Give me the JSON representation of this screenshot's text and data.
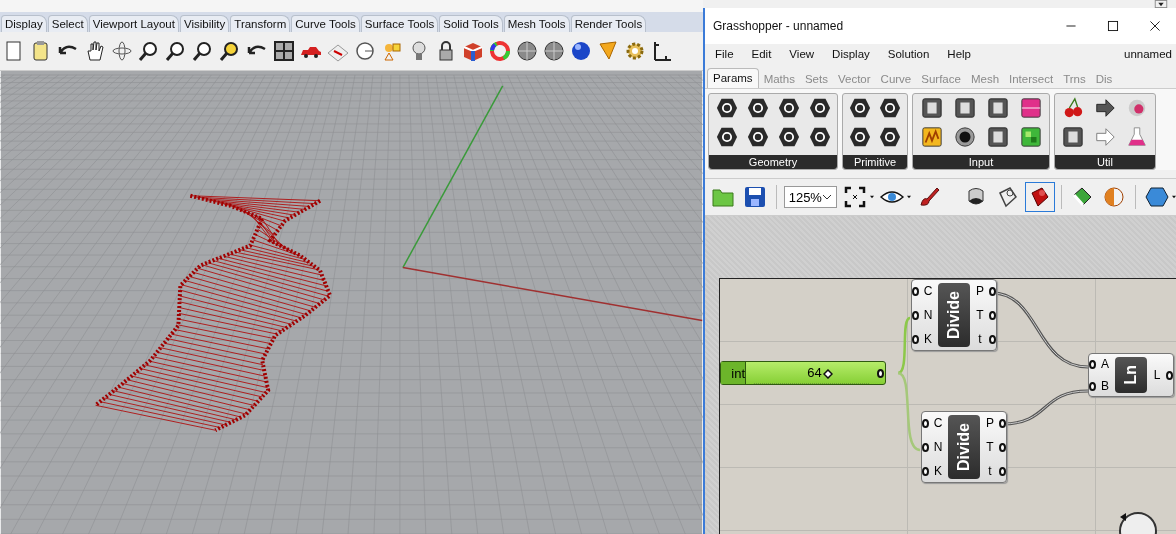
{
  "rhino": {
    "tabs": [
      {
        "label": "Display"
      },
      {
        "label": "Select"
      },
      {
        "label": "Viewport Layout"
      },
      {
        "label": "Visibility"
      },
      {
        "label": "Transform"
      },
      {
        "label": "Curve Tools"
      },
      {
        "label": "Surface Tools"
      },
      {
        "label": "Solid Tools"
      },
      {
        "label": "Mesh Tools"
      },
      {
        "label": "Render Tools"
      }
    ]
  },
  "grasshopper": {
    "title": "Grasshopper - unnamed",
    "menu": [
      "File",
      "Edit",
      "View",
      "Display",
      "Solution",
      "Help"
    ],
    "document_name": "unnamed",
    "tabs": [
      {
        "label": "Params",
        "selected": true
      },
      {
        "label": "Maths",
        "selected": false
      },
      {
        "label": "Sets",
        "selected": false
      },
      {
        "label": "Vector",
        "selected": false
      },
      {
        "label": "Curve",
        "selected": false
      },
      {
        "label": "Surface",
        "selected": false
      },
      {
        "label": "Mesh",
        "selected": false
      },
      {
        "label": "Intersect",
        "selected": false
      },
      {
        "label": "Trns",
        "selected": false
      },
      {
        "label": "Dis",
        "selected": false
      }
    ],
    "panels": [
      "Geometry",
      "Primitive",
      "Input",
      "Util"
    ],
    "zoom": "125%",
    "preview_modes": [
      {
        "selected": false
      },
      {
        "selected": false
      },
      {
        "selected": true
      }
    ],
    "canvas": {
      "slider": {
        "label": "int",
        "value": "64",
        "level": 0.64
      },
      "components": [
        {
          "name": "Divide",
          "inputs": [
            "C",
            "N",
            "K"
          ],
          "outputs": [
            "P",
            "T",
            "t"
          ]
        },
        {
          "name": "Divide",
          "inputs": [
            "C",
            "N",
            "K"
          ],
          "outputs": [
            "P",
            "T",
            "t"
          ]
        },
        {
          "name": "Ln",
          "inputs": [
            "A",
            "B"
          ],
          "outputs": [
            "L"
          ]
        }
      ]
    }
  }
}
